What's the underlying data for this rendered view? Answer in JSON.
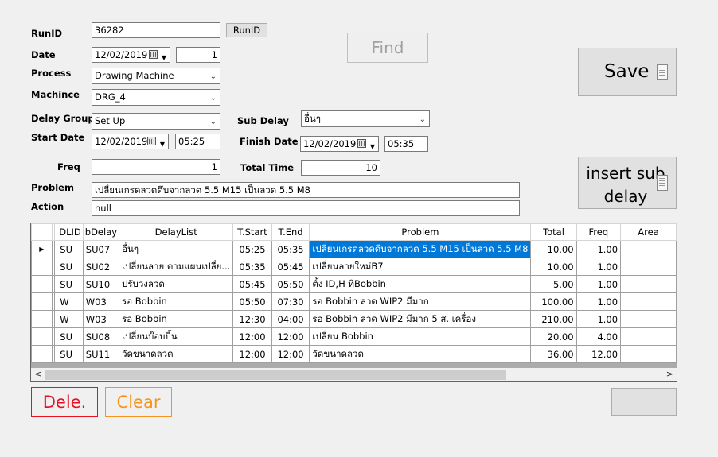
{
  "form": {
    "runid_label": "RunID",
    "runid_value": "36282",
    "runid_button": "RunID",
    "find_button": "Find",
    "save_button": "Save",
    "date_label": "Date",
    "date_value": "12/02/2019",
    "shift_value": "1",
    "process_label": "Process",
    "process_value": "Drawing Machine",
    "machine_label": "Machince",
    "machine_value": "DRG_4",
    "delay_group_label": "Delay Group",
    "delay_group_value": "Set Up",
    "sub_delay_label": "Sub Delay",
    "sub_delay_value": "อื่นๆ",
    "start_date_label": "Start Date",
    "start_date_value": "12/02/2019",
    "start_time_value": "05:25",
    "finish_date_label": "Finish Date",
    "finish_date_value": "12/02/2019",
    "finish_time_value": "05:35",
    "freq_label": "Freq",
    "freq_value": "1",
    "total_time_label": "Total Time",
    "total_time_value": "10",
    "insert_sub_delay_button_line1": "insert sub",
    "insert_sub_delay_button_line2": "delay",
    "problem_label": "Problem",
    "problem_value": "เปลี่ยนเกรดลวดดึบจากลวด 5.5 M15 เป็นลวด 5.5 M8",
    "action_label": "Action",
    "action_value": "null",
    "delete_button": "Dele.",
    "clear_button": "Clear",
    "colors": {
      "delete": "#e81123",
      "clear": "#f7941d",
      "selection": "#0078d7"
    }
  },
  "grid": {
    "columns": [
      "DLID",
      "bDelay",
      "DelayList",
      "T.Start",
      "T.End",
      "Problem",
      "Total",
      "Freq",
      "Area"
    ],
    "rows": [
      {
        "dlid": "SU",
        "bdelay": "SU07",
        "delaylist": "อื่นๆ",
        "tstart": "05:25",
        "tend": "05:35",
        "problem": "เปลี่ยนเกรดลวดดึบจากลวด 5.5 M15 เป็นลวด 5.5 M8",
        "total": "10.00",
        "freq": "1.00",
        "area": ""
      },
      {
        "dlid": "SU",
        "bdelay": "SU02",
        "delaylist": "เปลี่ยนลาย ตามแผนเปลี่ย...",
        "tstart": "05:35",
        "tend": "05:45",
        "problem": "เปลี่ยนลายใหม่B7",
        "total": "10.00",
        "freq": "1.00",
        "area": ""
      },
      {
        "dlid": "SU",
        "bdelay": "SU10",
        "delaylist": "ปรับวงลวด",
        "tstart": "05:45",
        "tend": "05:50",
        "problem": "ตั้ง ID,H ที่Bobbin",
        "total": "5.00",
        "freq": "1.00",
        "area": ""
      },
      {
        "dlid": "W",
        "bdelay": "W03",
        "delaylist": "รอ Bobbin",
        "tstart": "05:50",
        "tend": "07:30",
        "problem": "รอ Bobbin ลวด WIP2 มีมาก",
        "total": "100.00",
        "freq": "1.00",
        "area": ""
      },
      {
        "dlid": "W",
        "bdelay": "W03",
        "delaylist": "รอ Bobbin",
        "tstart": "12:30",
        "tend": "04:00",
        "problem": "รอ Bobbin ลวด WIP2 มีมาก 5 ส. เครื่อง",
        "total": "210.00",
        "freq": "1.00",
        "area": ""
      },
      {
        "dlid": "SU",
        "bdelay": "SU08",
        "delaylist": "เปลี่ยนบ๊อบบิ้น",
        "tstart": "12:00",
        "tend": "12:00",
        "problem": "เปลี่ยน Bobbin",
        "total": "20.00",
        "freq": "4.00",
        "area": ""
      },
      {
        "dlid": "SU",
        "bdelay": "SU11",
        "delaylist": "วัดขนาดลวด",
        "tstart": "12:00",
        "tend": "12:00",
        "problem": "วัดขนาดลวด",
        "total": "36.00",
        "freq": "12.00",
        "area": ""
      }
    ]
  }
}
